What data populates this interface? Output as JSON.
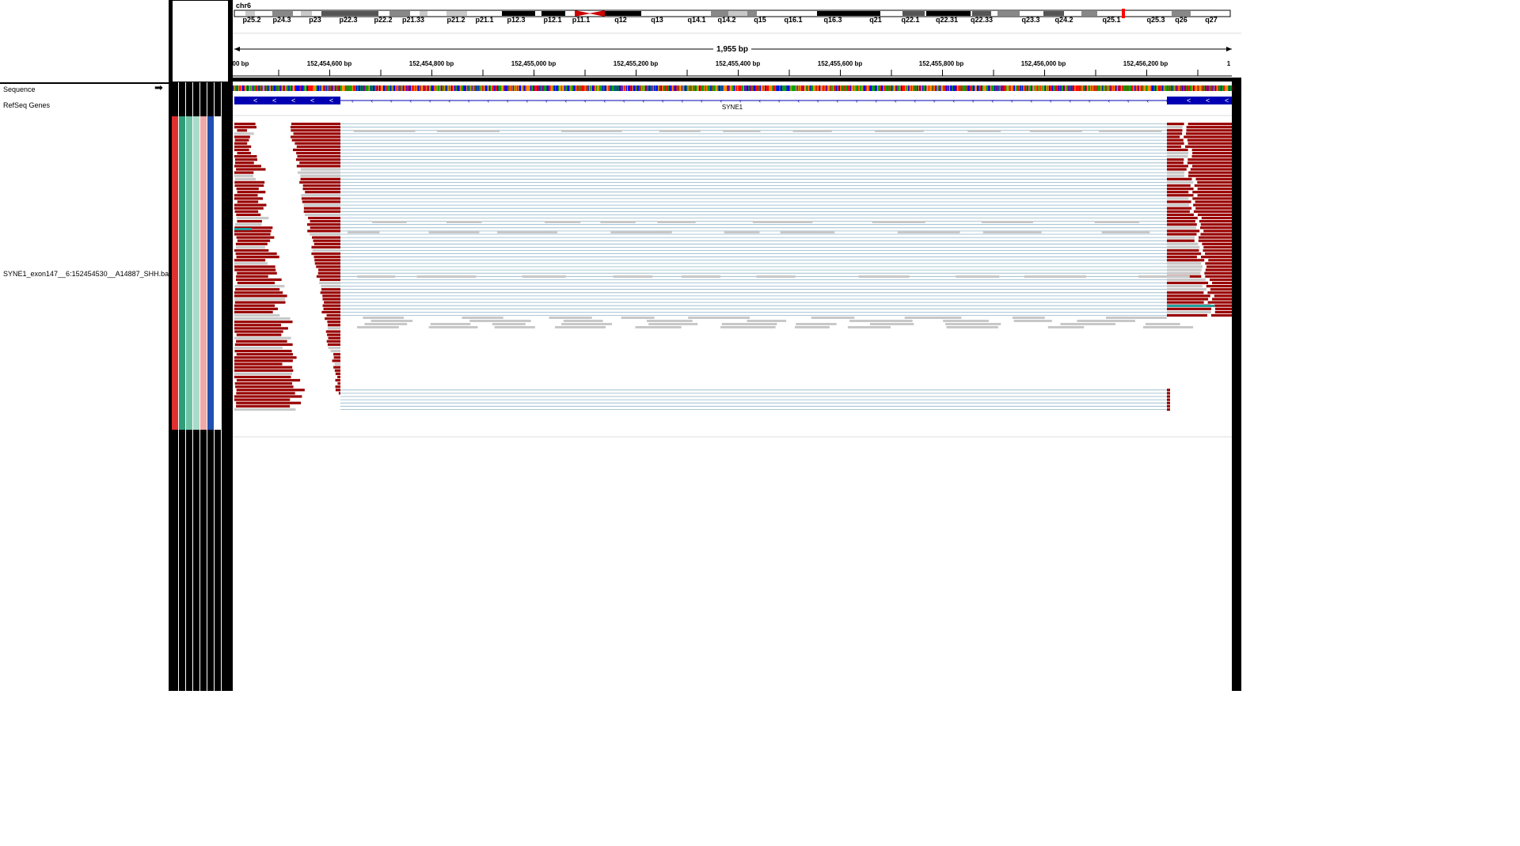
{
  "chromosome": {
    "name": "chr6",
    "bands": [
      "p25.2",
      "p24.3",
      "p23",
      "p22.3",
      "p22.2",
      "p21.33",
      "p21.2",
      "p21.1",
      "p12.3",
      "p12.1",
      "p11.1",
      "q12",
      "q13",
      "q14.1",
      "q14.2",
      "q15",
      "q16.1",
      "q16.3",
      "q21",
      "q22.1",
      "q22.31",
      "q22.33",
      "q23.3",
      "q24.2",
      "q25.1",
      "q25.3",
      "q26",
      "q27"
    ]
  },
  "ruler": {
    "span_label": "1,955 bp",
    "tick_labels": [
      "00 bp",
      "152,454,600 bp",
      "152,454,800 bp",
      "152,455,000 bp",
      "152,455,200 bp",
      "152,455,400 bp",
      "152,455,600 bp",
      "152,455,800 bp",
      "152,456,000 bp",
      "152,456,200 bp",
      "1"
    ]
  },
  "tracks": {
    "sequence_label": "Sequence",
    "refseq_label": "RefSeq Genes",
    "bam_label": "SYNE1_exon147__6:152454530__A14887_SHH.bam",
    "gene_name": "SYNE1"
  },
  "icons": {
    "strand_arrow": "right-arrow-icon"
  },
  "colors": {
    "read": "#990000",
    "soft_clip": "#c8c8c8",
    "gene": "#0000b2",
    "splice_line": "#8fb4c8",
    "centromere": "#cc0000",
    "current_position": "#ff0000"
  },
  "attribute_colors": [
    "#e03030",
    "#2f9e78",
    "#6fc4a6",
    "#a8dcc8",
    "#f0a8a8",
    "#2050b0",
    "#ffffff"
  ]
}
